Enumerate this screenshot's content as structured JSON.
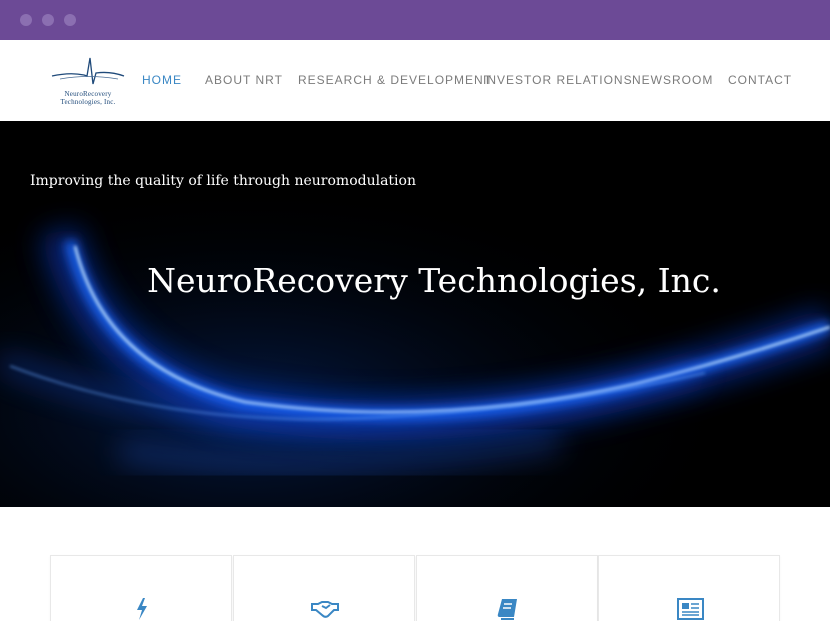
{
  "browser": {
    "window_controls": [
      "close",
      "minimize",
      "maximize"
    ],
    "accent_color": "#6c4a96"
  },
  "header": {
    "logo": {
      "line1": "NeuroRecovery",
      "line2": "Technologies, Inc."
    },
    "nav": [
      {
        "label": "HOME",
        "active": true
      },
      {
        "label": "ABOUT NRT",
        "active": false
      },
      {
        "label": "RESEARCH & DEVELOPMENT",
        "active": false
      },
      {
        "label": "INVESTOR RELATIONS",
        "active": false
      },
      {
        "label": "NEWSROOM",
        "active": false
      },
      {
        "label": "CONTACT",
        "active": false
      }
    ],
    "active_color": "#3a87c4"
  },
  "hero": {
    "tagline": "Improving the quality of life through neuromodulation",
    "title": "NeuroRecovery Technologies, Inc."
  },
  "features": [
    {
      "icon": "lightning-bolt-icon"
    },
    {
      "icon": "handshake-icon"
    },
    {
      "icon": "book-icon"
    },
    {
      "icon": "newspaper-icon"
    }
  ]
}
